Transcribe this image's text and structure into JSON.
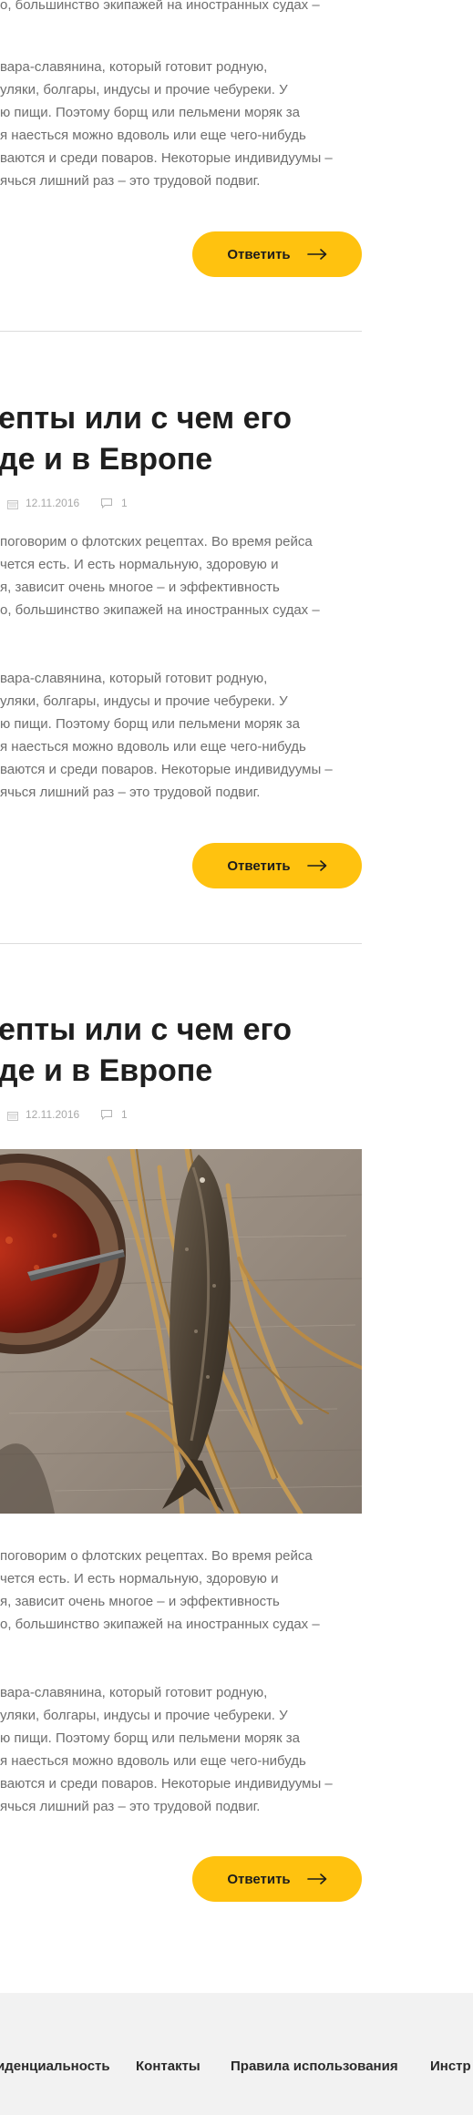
{
  "posts": [
    {
      "paragraph1": [
        "о, большинство экипажей на иностранных судах –"
      ],
      "paragraph2": [
        "вара-славянина, который готовит родную,",
        "уляки, болгары, индусы и прочие чебуреки. У",
        "ю пищи. Поэтому борщ или пельмени моряк за",
        "я наесться можно вдоволь или еще чего-нибудь",
        "ваются и среди поваров. Некоторые индивидуумы –",
        "ячься лишний раз – это трудовой подвиг."
      ],
      "reply_label": "Ответить"
    },
    {
      "title": [
        "епты или с чем его",
        "де и в Европе"
      ],
      "date": "12.11.2016",
      "comments": "1",
      "paragraph1": [
        "поговорим о флотских рецептах. Во время рейса",
        "чется есть. И есть нормальную, здоровую и",
        "я, зависит очень многое – и эффективность",
        "о, большинство экипажей на иностранных судах –"
      ],
      "paragraph2": [
        "вара-славянина, который готовит родную,",
        "уляки, болгары, индусы и прочие чебуреки. У",
        "ю пищи. Поэтому борщ или пельмени моряк за",
        "я наесться можно вдоволь или еще чего-нибудь",
        "ваются и среди поваров. Некоторые индивидуумы –",
        "ячься лишний раз – это трудовой подвиг."
      ],
      "reply_label": "Ответить"
    },
    {
      "title": [
        "епты или с чем его",
        "де и в Европе"
      ],
      "date": "12.11.2016",
      "comments": "1",
      "paragraph1": [
        "поговорим о флотских рецептах. Во время рейса",
        "чется есть. И есть нормальную, здоровую и",
        "я, зависит очень многое – и эффективность",
        "о, большинство экипажей на иностранных судах –"
      ],
      "paragraph2": [
        "вара-славянина, который готовит родную,",
        "уляки, болгары, индусы и прочие чебуреки. У",
        "ю пищи. Поэтому борщ или пельмени моряк за",
        "я наесться можно вдоволь или еще чего-нибудь",
        "ваются и среди поваров. Некоторые индивидуумы –",
        "ячься лишний раз – это трудовой подвиг."
      ],
      "reply_label": "Ответить"
    }
  ],
  "footer": {
    "links": [
      "иденциальность",
      "Контакты",
      "Правила использования",
      "Инстр"
    ]
  },
  "colors": {
    "accent": "#ffc20f",
    "text_dark": "#1f1f1f",
    "text_body": "#6e6e6e",
    "meta": "#a8a8a8",
    "footer_bg": "#f2f2f2"
  }
}
